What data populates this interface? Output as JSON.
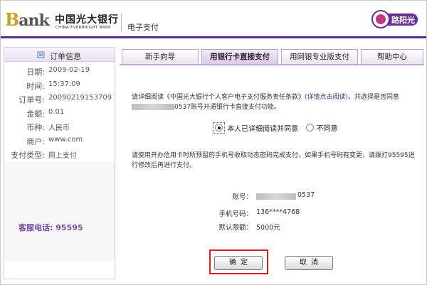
{
  "header": {
    "bank_logo_prefix": "B",
    "bank_logo_rest": "ank",
    "bank_name_cn": "中国光大银行",
    "bank_name_en": "CHINA EVERBRIGHT BANK",
    "section_title": "电子支付",
    "badge_text": "路阳光",
    "brand_color": "#5c2d86"
  },
  "sidebar": {
    "title": "订单信息",
    "rows": [
      {
        "label": "日期:",
        "value": "2009-02-19"
      },
      {
        "label": "时间:",
        "value": "15:37:09"
      },
      {
        "label": "订单号:",
        "value": "20090219153709"
      },
      {
        "label": "金额:",
        "value": "0.01"
      },
      {
        "label": "币种:",
        "value": "人民币"
      },
      {
        "label": "商户:",
        "value": "www.com"
      },
      {
        "label": "支付类型:",
        "value": "网上支付"
      }
    ],
    "hotline": "客服电话: 95595"
  },
  "tabs": [
    {
      "label": "新手向导",
      "active": false
    },
    {
      "label": "用银行卡直接支付",
      "active": true
    },
    {
      "label": "用网银专业版支付",
      "active": false
    },
    {
      "label": "帮助中心",
      "active": false
    }
  ],
  "content": {
    "intro_before": "请详细阅读《中国光大银行个人客户电子支付服务责任条款》",
    "intro_link": "(详情点击阅读)",
    "intro_mid": "，并选择是否同意",
    "intro_after": "0537账号开通银行卡直接支付功能。",
    "agree_label": "本人已详细阅读并同意",
    "disagree_label": "不同意",
    "notice": "请使用开办信用卡时所预留的手机号收取动态密码完成支付，如果手机号码有变更，请拨打95595进行修改后再进行支付。",
    "account_label": "账号：",
    "account_suffix": "0537",
    "phone_label": "手机号码：",
    "phone_value": "136****4768",
    "limit_label": "默认限额：",
    "limit_value": "5000元",
    "confirm_label": "确定",
    "cancel_label": "取消",
    "highlight_color": "#d81e1e"
  }
}
